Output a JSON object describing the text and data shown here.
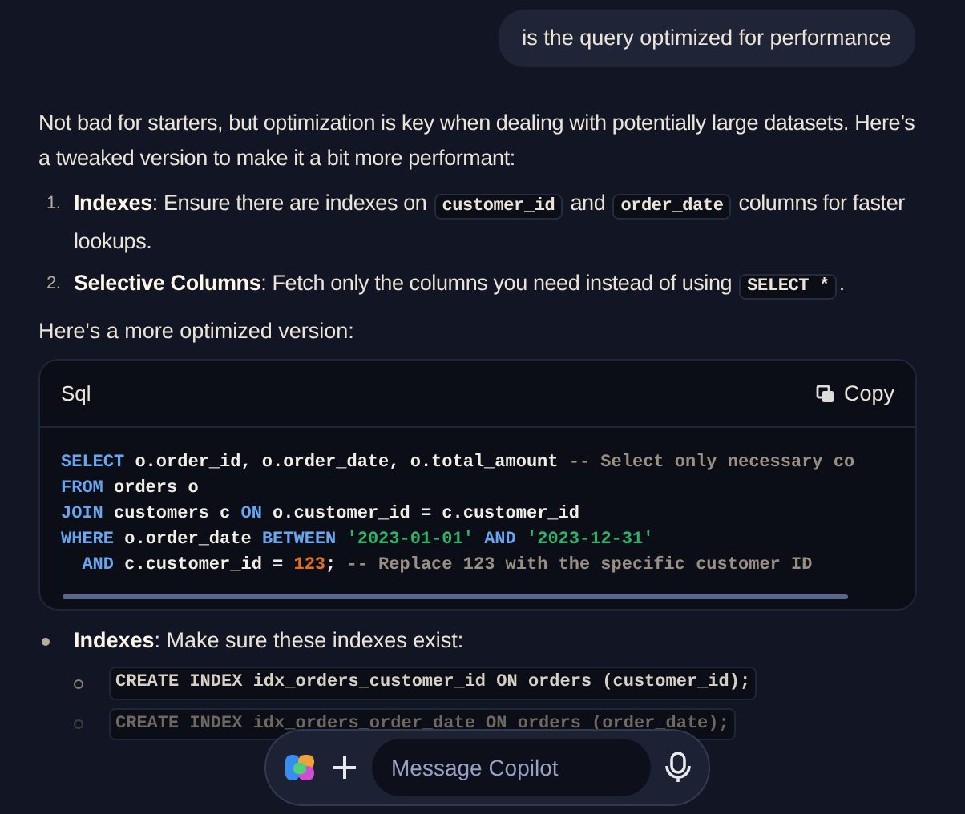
{
  "user_message": "is the query optimized for performance",
  "intro": "Not bad for starters, but optimization is key when dealing with potentially large datasets. Here’s a tweaked version to make it a bit more performant:",
  "numbered_list": [
    {
      "number": "1.",
      "parts": [
        {
          "kind": "bold",
          "text": "Indexes"
        },
        {
          "kind": "text",
          "text": ": Ensure there are indexes on "
        },
        {
          "kind": "code",
          "text": "customer_id"
        },
        {
          "kind": "text",
          "text": " and "
        },
        {
          "kind": "code",
          "text": "order_date"
        },
        {
          "kind": "text",
          "text": " columns for faster lookups."
        }
      ]
    },
    {
      "number": "2.",
      "parts": [
        {
          "kind": "bold",
          "text": "Selective Columns"
        },
        {
          "kind": "text",
          "text": ": Fetch only the columns you need instead of using "
        },
        {
          "kind": "code",
          "text": "SELECT *"
        },
        {
          "kind": "text",
          "text": "."
        }
      ]
    }
  ],
  "lead_in": "Here's a more optimized version:",
  "code_block": {
    "language": "Sql",
    "copy_label": "Copy",
    "lines": [
      [
        {
          "kind": "keyword",
          "text": "SELECT"
        },
        {
          "kind": "plain",
          "text": " o.order_id, o.order_date, o.total_amount "
        },
        {
          "kind": "comment",
          "text": "-- Select only necessary co"
        }
      ],
      [
        {
          "kind": "keyword",
          "text": "FROM"
        },
        {
          "kind": "plain",
          "text": " orders o"
        }
      ],
      [
        {
          "kind": "keyword",
          "text": "JOIN"
        },
        {
          "kind": "plain",
          "text": " customers c "
        },
        {
          "kind": "keyword",
          "text": "ON"
        },
        {
          "kind": "plain",
          "text": " o.customer_id = c.customer_id"
        }
      ],
      [
        {
          "kind": "keyword",
          "text": "WHERE"
        },
        {
          "kind": "plain",
          "text": " o.order_date "
        },
        {
          "kind": "keyword",
          "text": "BETWEEN"
        },
        {
          "kind": "string",
          "text": " '2023-01-01' "
        },
        {
          "kind": "keyword",
          "text": "AND"
        },
        {
          "kind": "string",
          "text": " '2023-12-31'"
        }
      ],
      [
        {
          "kind": "keyword",
          "text": "  AND"
        },
        {
          "kind": "plain",
          "text": " c.customer_id = "
        },
        {
          "kind": "number",
          "text": "123"
        },
        {
          "kind": "plain",
          "text": "; "
        },
        {
          "kind": "comment",
          "text": "-- Replace 123 with the specific customer ID"
        }
      ]
    ]
  },
  "bullet_list": [
    {
      "parts": [
        {
          "kind": "bold",
          "text": "Indexes"
        },
        {
          "kind": "text",
          "text": ": Make sure these indexes exist:"
        }
      ],
      "children": [
        {
          "code": "CREATE INDEX idx_orders_customer_id ON orders (customer_id);",
          "dimmed": false
        },
        {
          "code": "CREATE INDEX idx_orders_order_date ON orders (order_date);",
          "dimmed": true
        }
      ]
    }
  ],
  "composer": {
    "placeholder": "Message Copilot"
  }
}
